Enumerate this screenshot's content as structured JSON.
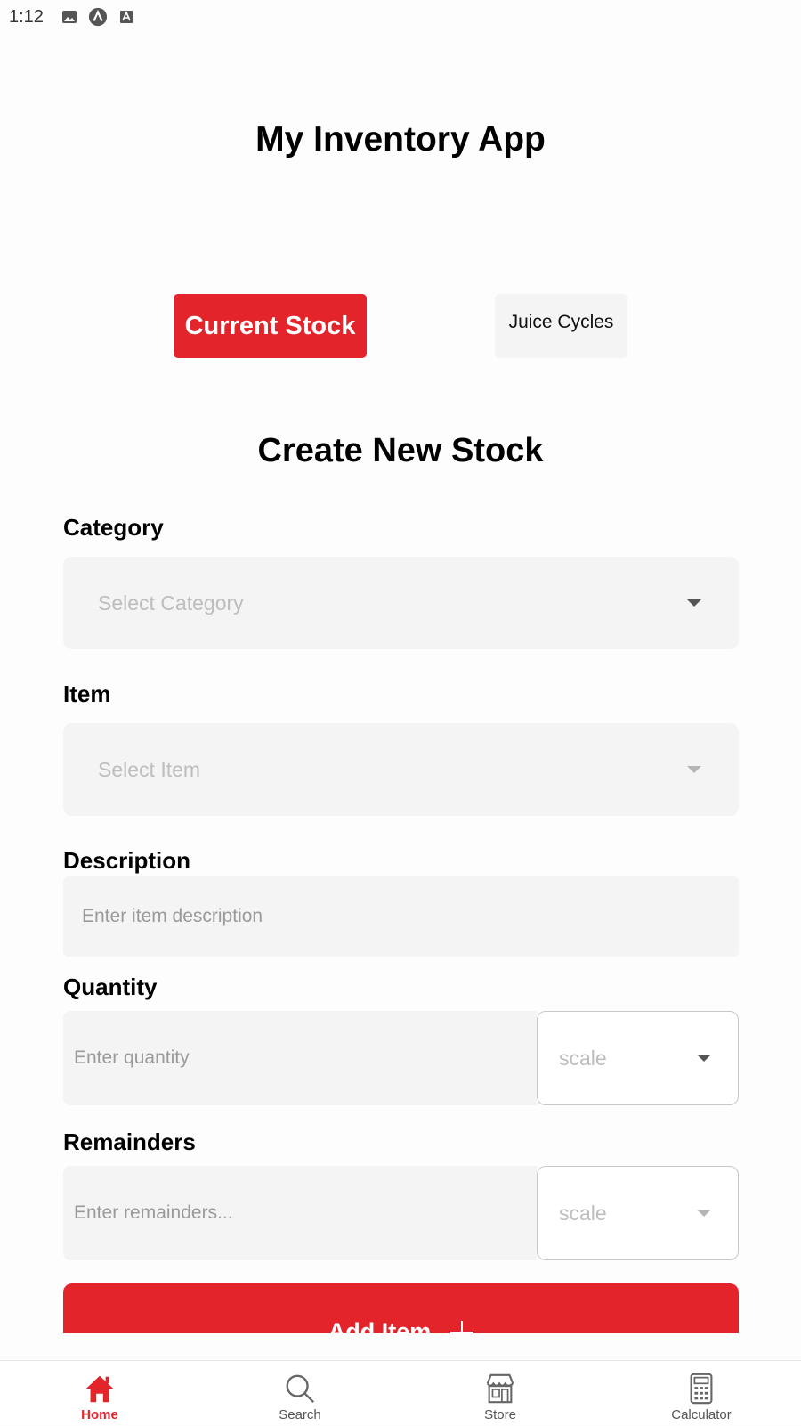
{
  "status_bar": {
    "time": "1:12",
    "icons": [
      "image-icon",
      "app-a-icon",
      "text-a-icon"
    ]
  },
  "app_title": "My Inventory App",
  "top_buttons": {
    "current_stock": "Current Stock",
    "juice_cycles": "Juice Cycles"
  },
  "section_title": "Create New Stock",
  "form": {
    "category": {
      "label": "Category",
      "placeholder": "Select Category"
    },
    "item": {
      "label": "Item",
      "placeholder": "Select Item"
    },
    "description": {
      "label": "Description",
      "placeholder": "Enter item description"
    },
    "quantity": {
      "label": "Quantity",
      "placeholder": "Enter quantity",
      "scale_placeholder": "scale"
    },
    "remainders": {
      "label": "Remainders",
      "placeholder": "Enter remainders...",
      "scale_placeholder": "scale"
    },
    "add_button": "Add Item"
  },
  "tab_bar": {
    "tabs": [
      {
        "label": "Home",
        "icon": "home-icon",
        "active": true
      },
      {
        "label": "Search",
        "icon": "search-icon",
        "active": false
      },
      {
        "label": "Store",
        "icon": "store-icon",
        "active": false
      },
      {
        "label": "Calculator",
        "icon": "calculator-icon",
        "active": false
      }
    ]
  },
  "colors": {
    "accent": "#e3252b",
    "input_bg": "#f4f4f4",
    "placeholder": "#bdbdbd"
  }
}
